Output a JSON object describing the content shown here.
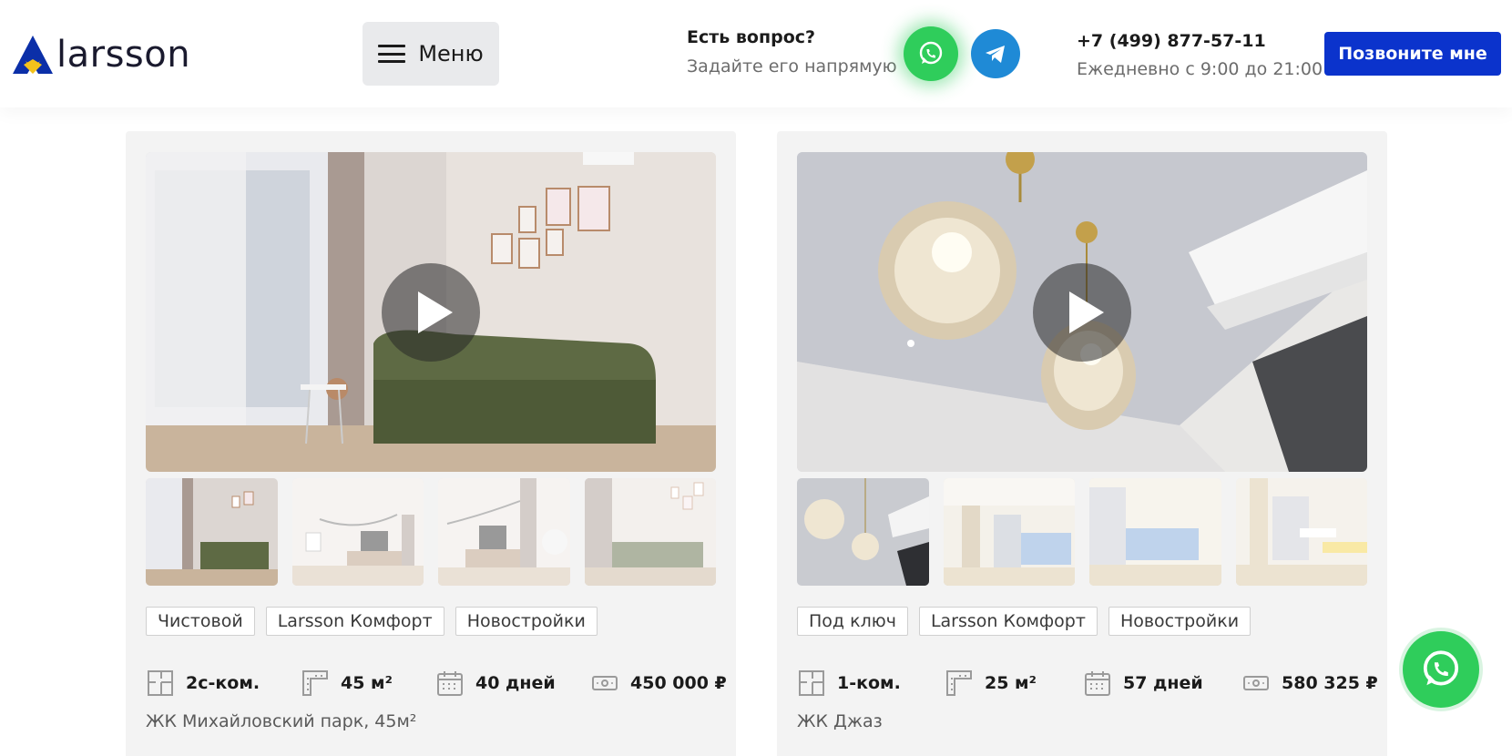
{
  "header": {
    "logo_text": "larsson",
    "menu_label": "Меню",
    "question_title": "Есть вопрос?",
    "question_sub": "Задайте его напрямую",
    "whatsapp_icon": "whatsapp-icon",
    "telegram_icon": "telegram-icon",
    "phone_number": "+7 (499) 877-57-11",
    "phone_hours": "Ежедневно с 9:00 до 21:00",
    "call_button": "Позвоните мне"
  },
  "colors": {
    "accent_blue": "#0b33cc",
    "whatsapp_green": "#2fcd5b",
    "telegram_blue": "#1f8ad6",
    "logo_yellow": "#f3c21b"
  },
  "cards": [
    {
      "tags": [
        "Чистовой",
        "Larsson Комфорт",
        "Новостройки"
      ],
      "rooms": "2с-ком.",
      "area": "45 м²",
      "duration": "40 дней",
      "price": "450 000 ₽",
      "address": "ЖК Михайловский парк, 45м²"
    },
    {
      "tags": [
        "Под ключ",
        "Larsson Комфорт",
        "Новостройки"
      ],
      "rooms": "1-ком.",
      "area": "25 м²",
      "duration": "57 дней",
      "price": "580 325 ₽",
      "address": "ЖК Джаз"
    }
  ]
}
